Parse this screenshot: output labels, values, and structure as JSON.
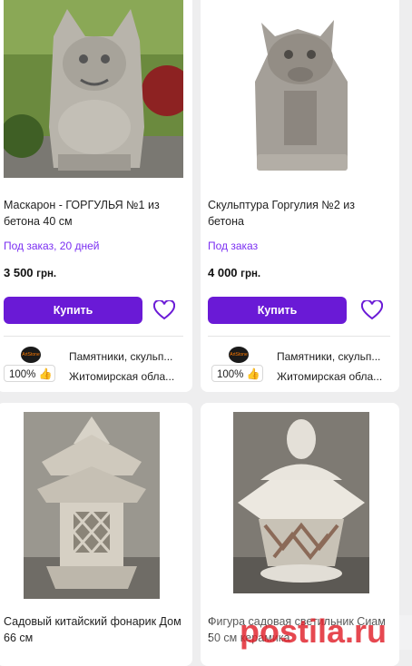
{
  "products": [
    {
      "title": "Маскарон - ГОРГУЛЬЯ №1 из бетона 40 см",
      "availability": "Под заказ, 20 дней",
      "price": "3 500",
      "currency": "грн.",
      "buy_label": "Купить",
      "seller": {
        "logo_text": "ArtStone",
        "rating": "100%",
        "category": "Памятники, скульп...",
        "location": "Житомирская обла..."
      }
    },
    {
      "title": "Скульптура Горгулия №2 из бетона",
      "availability": "Под заказ",
      "price": "4 000",
      "currency": "грн.",
      "buy_label": "Купить",
      "seller": {
        "logo_text": "ArtStone",
        "rating": "100%",
        "category": "Памятники, скульп...",
        "location": "Житомирская обла..."
      }
    },
    {
      "title": "Садовый китайский фонарик Дом 66 см"
    },
    {
      "title": "Фигура садовая светильник Сиам 50 см керамика"
    }
  ],
  "watermark": "postila.ru",
  "colors": {
    "accent": "#6a1ad6",
    "availability": "#7b2ff2",
    "background": "#eeeeef",
    "watermark": "#e0202a"
  }
}
